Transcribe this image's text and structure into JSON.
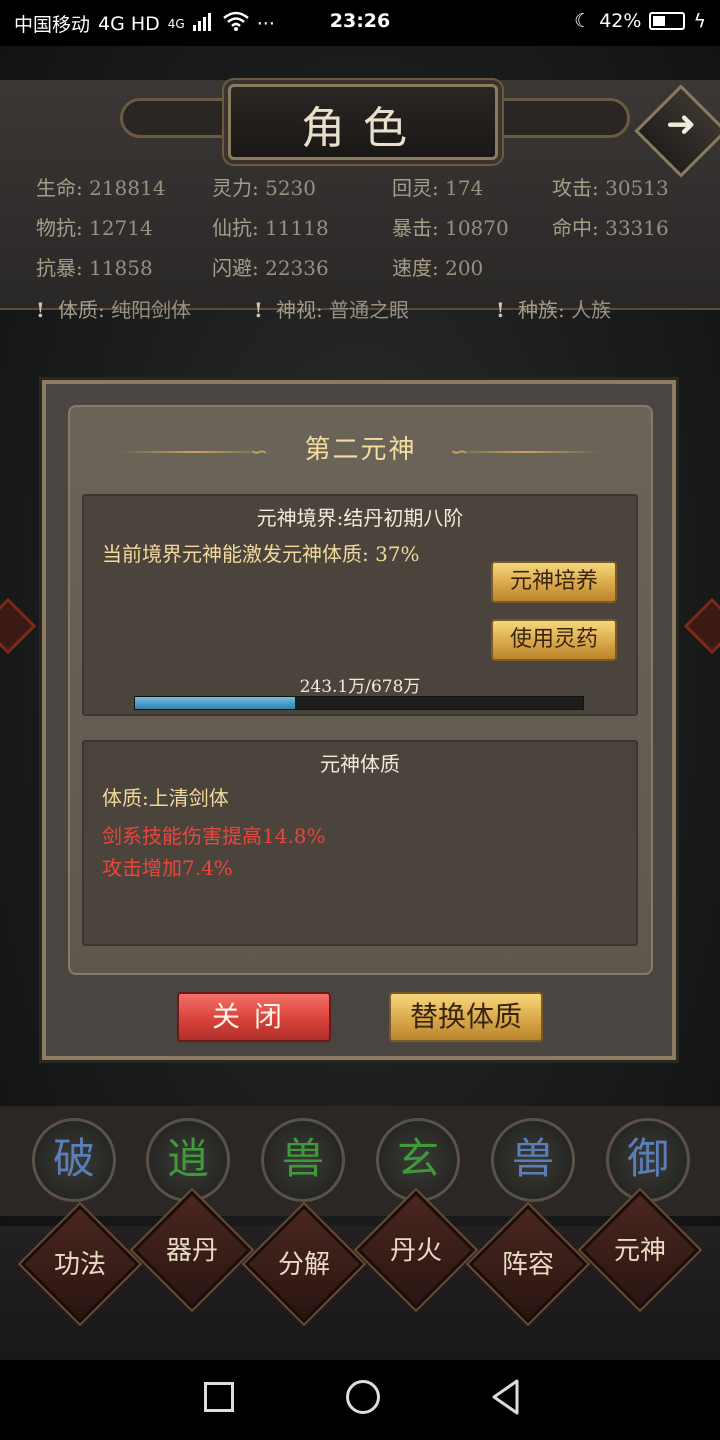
{
  "statusbar": {
    "carrier": "中国移动",
    "network": "4G HD",
    "signal_tag": "4G",
    "time": "23:26",
    "battery": "42%",
    "battery_level": 0.42
  },
  "header": {
    "title": "角色",
    "arrow_icon": "arrow-right-icon"
  },
  "stats": [
    {
      "label": "生命:",
      "value": "218814"
    },
    {
      "label": "灵力:",
      "value": "5230"
    },
    {
      "label": "回灵:",
      "value": "174"
    },
    {
      "label": "攻击:",
      "value": "30513"
    },
    {
      "label": "物抗:",
      "value": "12714"
    },
    {
      "label": "仙抗:",
      "value": "11118"
    },
    {
      "label": "暴击:",
      "value": "10870"
    },
    {
      "label": "命中:",
      "value": "33316"
    },
    {
      "label": "抗暴:",
      "value": "11858"
    },
    {
      "label": "闪避:",
      "value": "22336"
    },
    {
      "label": "速度:",
      "value": "200"
    }
  ],
  "traits": [
    {
      "label": "体质:",
      "value": "纯阳剑体"
    },
    {
      "label": "神视:",
      "value": "普通之眼"
    },
    {
      "label": "种族:",
      "value": "人族"
    }
  ],
  "modal": {
    "title": "第二元神",
    "realm": "元神境界:结丹初期八阶",
    "activation": "当前境界元神能激发元神体质: 37%",
    "cultivate_button": "元神培养",
    "elixir_button": "使用灵药",
    "progress_text": "243.1万/678万",
    "progress_fraction": 0.358,
    "constitution_header": "元神体质",
    "constitution": "体质:上清剑体",
    "effects": [
      "剑系技能伤害提高14.8%",
      "攻击增加7.4%"
    ],
    "close_button": "关闭",
    "replace_button": "替换体质"
  },
  "skills": [
    {
      "char": "破",
      "color": "#5a7fb8"
    },
    {
      "char": "逍",
      "color": "#3f9a3a"
    },
    {
      "char": "兽",
      "color": "#3f9a3a"
    },
    {
      "char": "玄",
      "color": "#3f9a3a"
    },
    {
      "char": "兽",
      "color": "#5a7fb8"
    },
    {
      "char": "御",
      "color": "#5a7fb8"
    }
  ],
  "bottom_menu": [
    "功法",
    "器丹",
    "分解",
    "丹火",
    "阵容",
    "元神"
  ]
}
